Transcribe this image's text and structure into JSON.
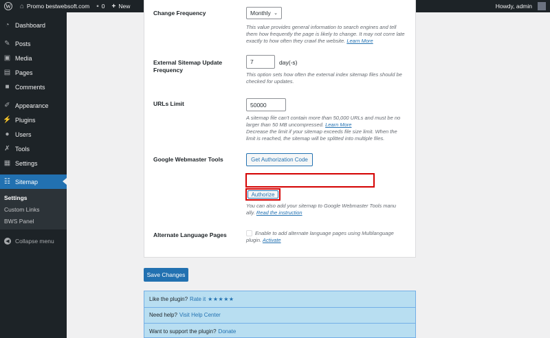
{
  "adminbar": {
    "site_name": "Promo bestwebsoft.com",
    "comments_count": "0",
    "new_label": "New",
    "howdy": "Howdy, admin"
  },
  "sidebar": {
    "items": [
      {
        "label": "Dashboard",
        "icon": "dashboard-icon"
      },
      {
        "label": "Posts",
        "icon": "pin-icon"
      },
      {
        "label": "Media",
        "icon": "media-icon"
      },
      {
        "label": "Pages",
        "icon": "pages-icon"
      },
      {
        "label": "Comments",
        "icon": "comments-icon"
      },
      {
        "label": "Appearance",
        "icon": "brush-icon"
      },
      {
        "label": "Plugins",
        "icon": "plugin-icon"
      },
      {
        "label": "Users",
        "icon": "users-icon"
      },
      {
        "label": "Tools",
        "icon": "wrench-icon"
      },
      {
        "label": "Settings",
        "icon": "settings-icon"
      },
      {
        "label": "Sitemap",
        "icon": "sitemap-icon"
      }
    ],
    "submenu": [
      "Settings",
      "Custom Links",
      "BWS Panel"
    ],
    "collapse_label": "Collapse menu"
  },
  "form": {
    "change_frequency": {
      "label": "Change Frequency",
      "value": "Monthly",
      "desc": "This value provides general information to search engines and tell them how frequently the page is likely to change. It may not corre late exactly to how often they crawl the website.",
      "link": "Learn More"
    },
    "external_update": {
      "label": "External Sitemap Update Frequency",
      "value": "7",
      "unit": "day(-s)",
      "desc": "This option sets how often the external index sitemap files should be checked for updates."
    },
    "urls_limit": {
      "label": "URLs Limit",
      "value": "50000",
      "desc1": "A sitemap file can't contain more than 50,000 URLs and must be no larger than 50 MB uncompressed.",
      "link": "Learn More",
      "desc2": "Decrease the limit if your sitemap exceeds file size limit. When the limit is reached, the sitemap will be splitted into multiple files."
    },
    "gwt": {
      "label": "Google Webmaster Tools",
      "get_code_button": "Get Authorization Code",
      "code_value": "",
      "authorize_button": "Authorize",
      "desc": "You can also add your sitemap to Google Webmaster Tools manu ally.",
      "link": "Read the instruction"
    },
    "alt_lang": {
      "label": "Alternate Language Pages",
      "desc": "Enable to add alternate language pages using Multilanguage plugin.",
      "link": "Activate"
    }
  },
  "save_button": "Save Changes",
  "info": {
    "rate_text": "Like the plugin?",
    "rate_link": "Rate it",
    "stars": "★★★★★",
    "help_text": "Need help?",
    "help_link": "Visit Help Center",
    "support_text": "Want to support the plugin?",
    "support_link": "Donate"
  },
  "colors": {
    "accent": "#2271b1",
    "sidebar_bg": "#1d2327",
    "highlight_red": "#d40000",
    "info_bg": "#b8def1"
  }
}
